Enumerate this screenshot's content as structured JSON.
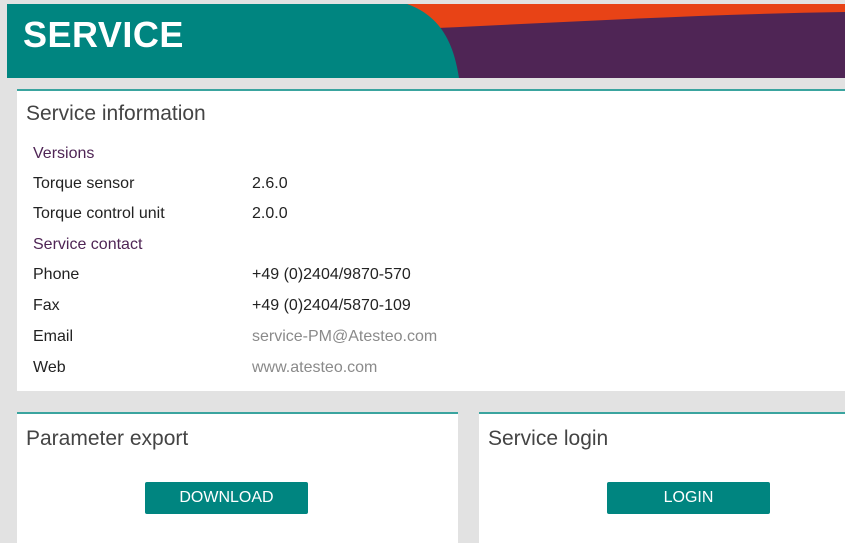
{
  "header": {
    "title": "SERVICE"
  },
  "colors": {
    "teal": "#008580",
    "purple": "#4f2555",
    "orange": "#e84316"
  },
  "service_info": {
    "title": "Service information",
    "versions_heading": "Versions",
    "torque_sensor_label": "Torque sensor",
    "torque_sensor_value": "2.6.0",
    "control_unit_label": "Torque control unit",
    "control_unit_value": "2.0.0",
    "contact_heading": "Service contact",
    "phone_label": "Phone",
    "phone_value": "+49 (0)2404/9870-570",
    "fax_label": "Fax",
    "fax_value": "+49 (0)2404/5870-109",
    "email_label": "Email",
    "email_value": "service-PM@Atesteo.com",
    "web_label": "Web",
    "web_value": "www.atesteo.com"
  },
  "parameter_export": {
    "title": "Parameter export",
    "button_label": "DOWNLOAD"
  },
  "service_login": {
    "title": "Service login",
    "button_label": "LOGIN"
  }
}
